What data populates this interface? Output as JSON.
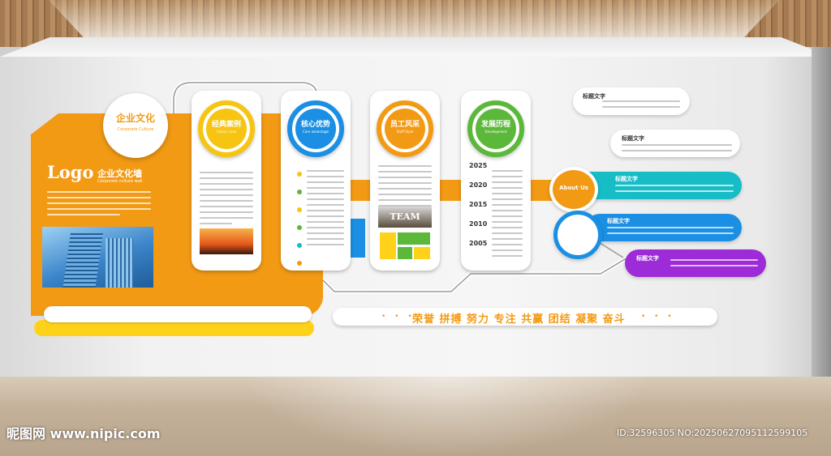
{
  "wall": {
    "culture_title": "企业文化",
    "culture_sub": "Corporate Culture",
    "logo": "Logo",
    "logo_title": "企业文化墙",
    "logo_sub": "Corporate culture wall"
  },
  "cards": [
    {
      "label": "经典案例",
      "sub": "Classic case",
      "color": "#f6c411"
    },
    {
      "label": "核心优势",
      "sub": "Core advantage",
      "color": "#1a8fe3"
    },
    {
      "label": "员工风采",
      "sub": "Staff Style",
      "color": "#f39a14"
    },
    {
      "label": "发展历程",
      "sub": "Development",
      "color": "#5cb83a"
    }
  ],
  "team_label": "TEAM",
  "years": [
    "2025",
    "2020",
    "2015",
    "2010",
    "2005"
  ],
  "right": {
    "title1": "标题文字",
    "title2": "标题文字",
    "title3": "标题文字",
    "title4": "标题文字",
    "title5": "标题文字",
    "about": "About Us"
  },
  "motto": {
    "dots": "• • •",
    "text": "荣誉 拼搏 努力 专注 共赢 团结 凝聚 奋斗",
    "dots_right": "• • •"
  },
  "colors": {
    "orange": "#f39a14",
    "yellow": "#ffd21a",
    "blue": "#1a8fe3",
    "cyan": "#16bcc6",
    "purple": "#9d2bd8",
    "green": "#5cb83a"
  },
  "watermark": {
    "left": "昵图网 www.nipic.com",
    "right": "ID:32596305 NO:20250627095112599105"
  }
}
